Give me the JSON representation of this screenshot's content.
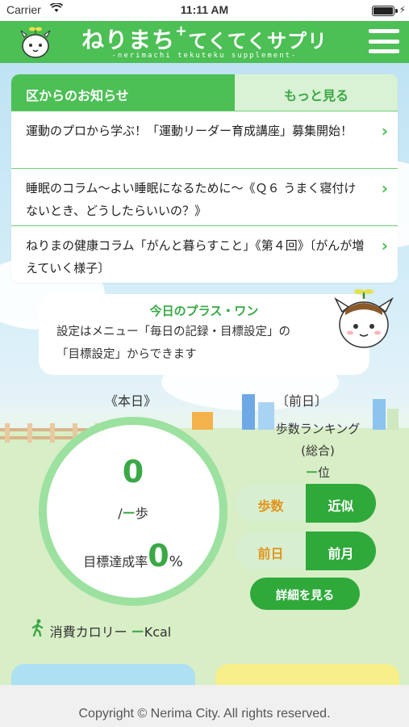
{
  "status": {
    "carrier": "Carrier",
    "time": "11:11 AM"
  },
  "header": {
    "title_main": "ねりまち",
    "title_plus": "+",
    "title_rest": "てくてくサプリ",
    "subtitle": "-nerimachi tekuteku supplement-"
  },
  "news": {
    "tab_label": "区からのお知らせ",
    "more_label": "もっと見る",
    "items": [
      {
        "text": "運動のプロから学ぶ！「運動リーダー育成講座」募集開始！"
      },
      {
        "text": "睡眠のコラム〜よい睡眠になるために〜《Ｑ６ うまく寝付けないとき、どうしたらいいの？》"
      },
      {
        "text": "ねりまの健康コラム「がんと暮らすこと」《第４回》〔がんが増えていく様子〕"
      }
    ]
  },
  "plus_one": {
    "title": "今日のプラス・ワン",
    "line1": "設定はメニュー「毎日の記録・目標設定」の",
    "line2": "「目標設定」からできます"
  },
  "today": {
    "label": "《本日》",
    "steps": "0",
    "steps_prefix": "/",
    "steps_dash": "ー",
    "steps_unit": "歩",
    "rate_label": "目標達成率",
    "rate_value": "0",
    "rate_unit": "%"
  },
  "previous": {
    "label": "〔前日〕",
    "ranking_title": "歩数ランキング",
    "ranking_sub": "(総合)",
    "rank_dash": "ー",
    "rank_unit": "位"
  },
  "toggles": {
    "t1_off": "歩数",
    "t1_on": "近似",
    "t2_off": "前日",
    "t2_on": "前月",
    "detail": "詳細を見る"
  },
  "calorie": {
    "label": "消費カロリー",
    "dash": "ー",
    "unit": "Kcal"
  },
  "footer": {
    "copyright": "Copyright © Nerima City. All rights reserved."
  },
  "colors": {
    "brand_green": "#4cbf55",
    "dark_green": "#2ea93a",
    "orange": "#e2941a"
  }
}
